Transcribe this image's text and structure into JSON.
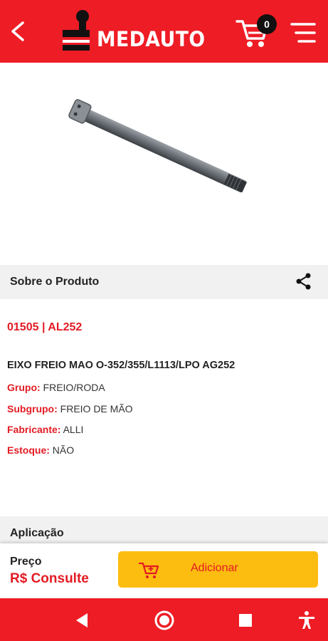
{
  "header": {
    "brand": "MEDAUTO",
    "cart_count": "0",
    "icons": [
      "back-arrow-icon",
      "cart-icon",
      "hamburger-menu-icon"
    ],
    "colors": {
      "brand_red": "#ee1c25",
      "button_yellow": "#fdbc10",
      "label_red": "#e31b23"
    }
  },
  "product": {
    "image": "steel-brake-shaft-photo",
    "about_title": "Sobre o Produto",
    "code": "01505 | AL252",
    "description": "EIXO FREIO MAO O-352/355/L1113/LPO AG252",
    "attributes": [
      {
        "key": "Grupo:",
        "value": "FREIO/RODA"
      },
      {
        "key": "Subgrupo:",
        "value": "FREIO DE MÃO"
      },
      {
        "key": "Fabricante:",
        "value": "ALLI"
      },
      {
        "key": "Estoque:",
        "value": "NÃO"
      }
    ]
  },
  "application": {
    "title": "Aplicação"
  },
  "footer": {
    "price_label": "Preço",
    "price_value": "R$ Consulte",
    "add_label": "Adicionar"
  },
  "android_nav": {
    "icons": [
      "nav-back-icon",
      "nav-home-icon",
      "nav-recents-icon",
      "accessibility-icon"
    ]
  }
}
